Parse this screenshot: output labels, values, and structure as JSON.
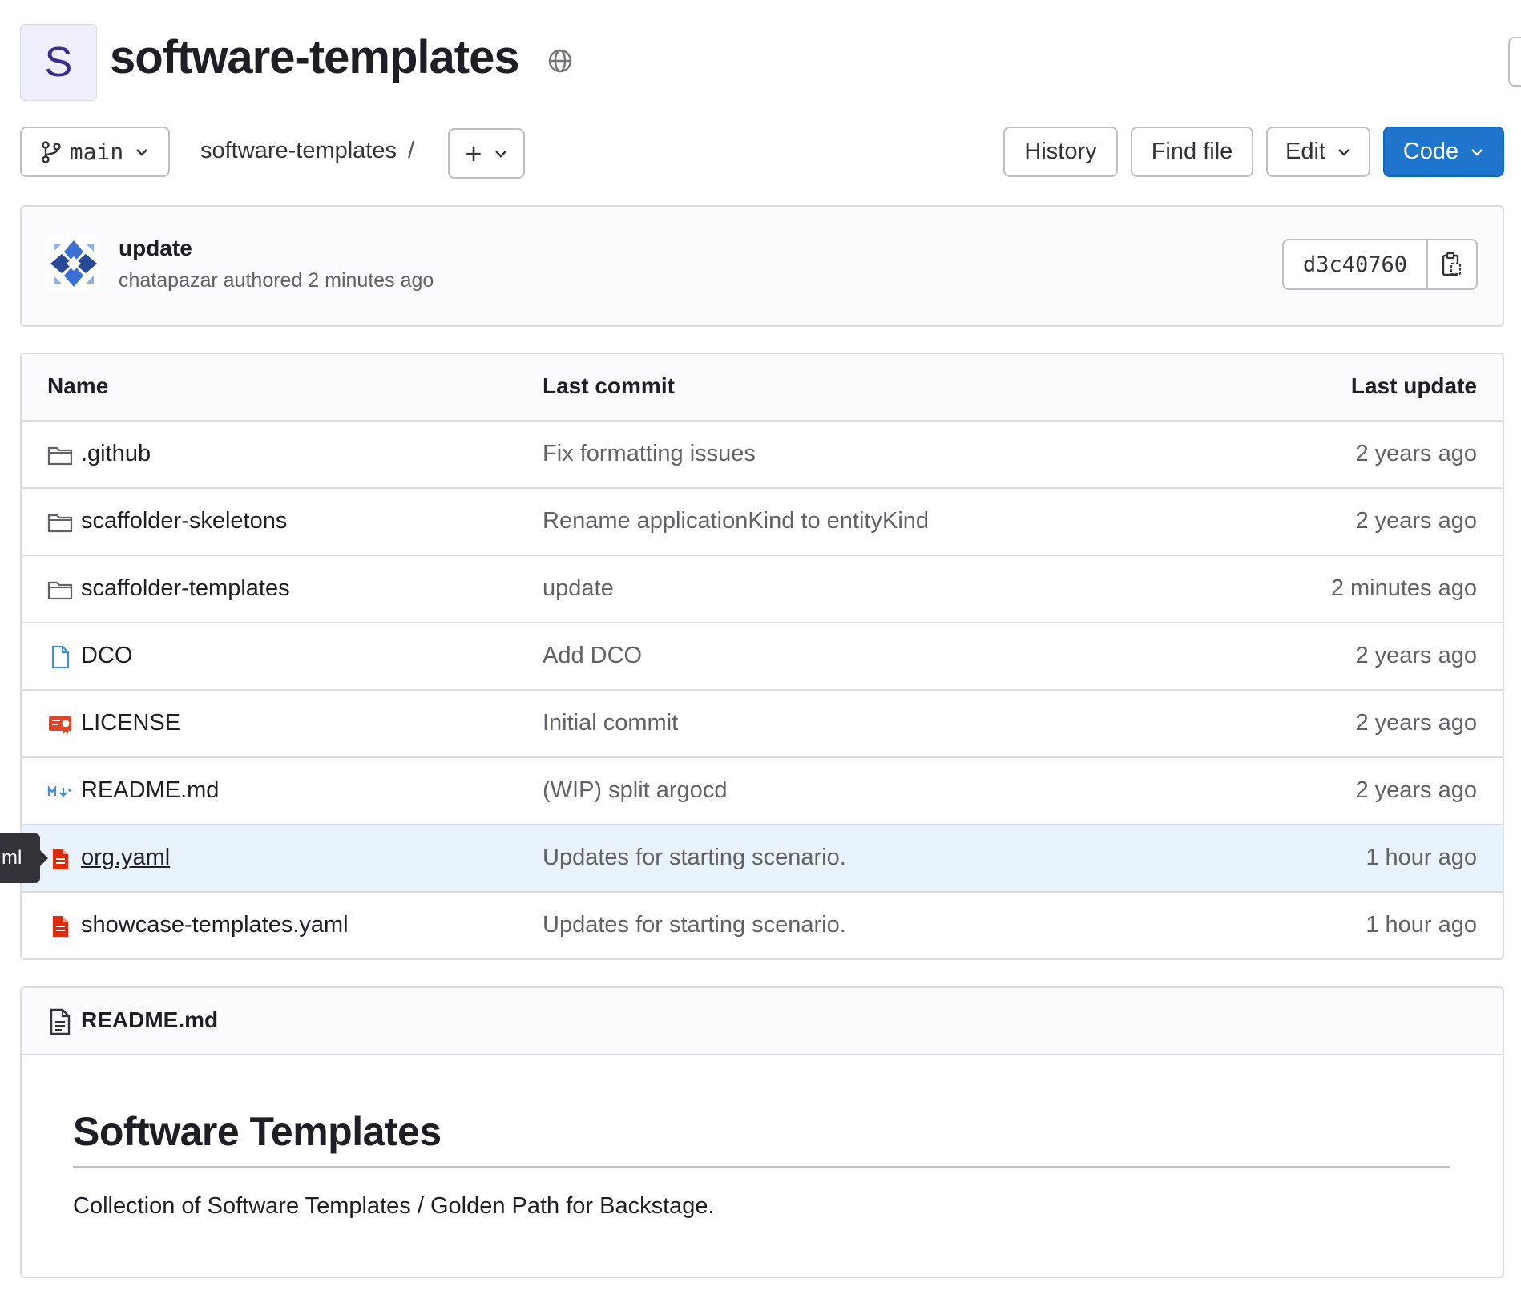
{
  "project": {
    "avatar_letter": "S",
    "name": "software-templates"
  },
  "toolbar": {
    "branch": "main",
    "breadcrumb": "software-templates",
    "breadcrumb_sep": "/",
    "add_label": "+",
    "history_label": "History",
    "find_file_label": "Find file",
    "edit_label": "Edit",
    "code_label": "Code"
  },
  "last_commit": {
    "title": "update",
    "author": "chatapazar",
    "meta_suffix": "authored 2 minutes ago",
    "sha": "d3c40760"
  },
  "table": {
    "headers": {
      "name": "Name",
      "last_commit": "Last commit",
      "last_update": "Last update"
    },
    "rows": [
      {
        "icon": "folder-icon",
        "name": ".github",
        "commit": "Fix formatting issues",
        "updated": "2 years ago"
      },
      {
        "icon": "folder-icon",
        "name": "scaffolder-skeletons",
        "commit": "Rename applicationKind to entityKind",
        "updated": "2 years ago"
      },
      {
        "icon": "folder-icon",
        "name": "scaffolder-templates",
        "commit": "update",
        "updated": "2 minutes ago"
      },
      {
        "icon": "file-icon",
        "name": "DCO",
        "commit": "Add DCO",
        "updated": "2 years ago"
      },
      {
        "icon": "license-icon",
        "name": "LICENSE",
        "commit": "Initial commit",
        "updated": "2 years ago"
      },
      {
        "icon": "markdown-icon",
        "name": "README.md",
        "commit": "(WIP) split argocd",
        "updated": "2 years ago"
      },
      {
        "icon": "yaml-icon",
        "name": "org.yaml",
        "commit": "Updates for starting scenario.",
        "updated": "1 hour ago"
      },
      {
        "icon": "yaml-icon",
        "name": "showcase-templates.yaml",
        "commit": "Updates for starting scenario.",
        "updated": "1 hour ago"
      }
    ]
  },
  "tooltip": {
    "text": "ml"
  },
  "readme": {
    "file_label": "README.md",
    "heading": "Software Templates",
    "body": "Collection of Software Templates / Golden Path for Backstage."
  },
  "colors": {
    "primary": "#1f75cb",
    "row_highlight": "#e9f3fc",
    "yaml_icon": "#dd2b0e",
    "license_icon": "#e24329",
    "file_icon": "#428fdc"
  }
}
